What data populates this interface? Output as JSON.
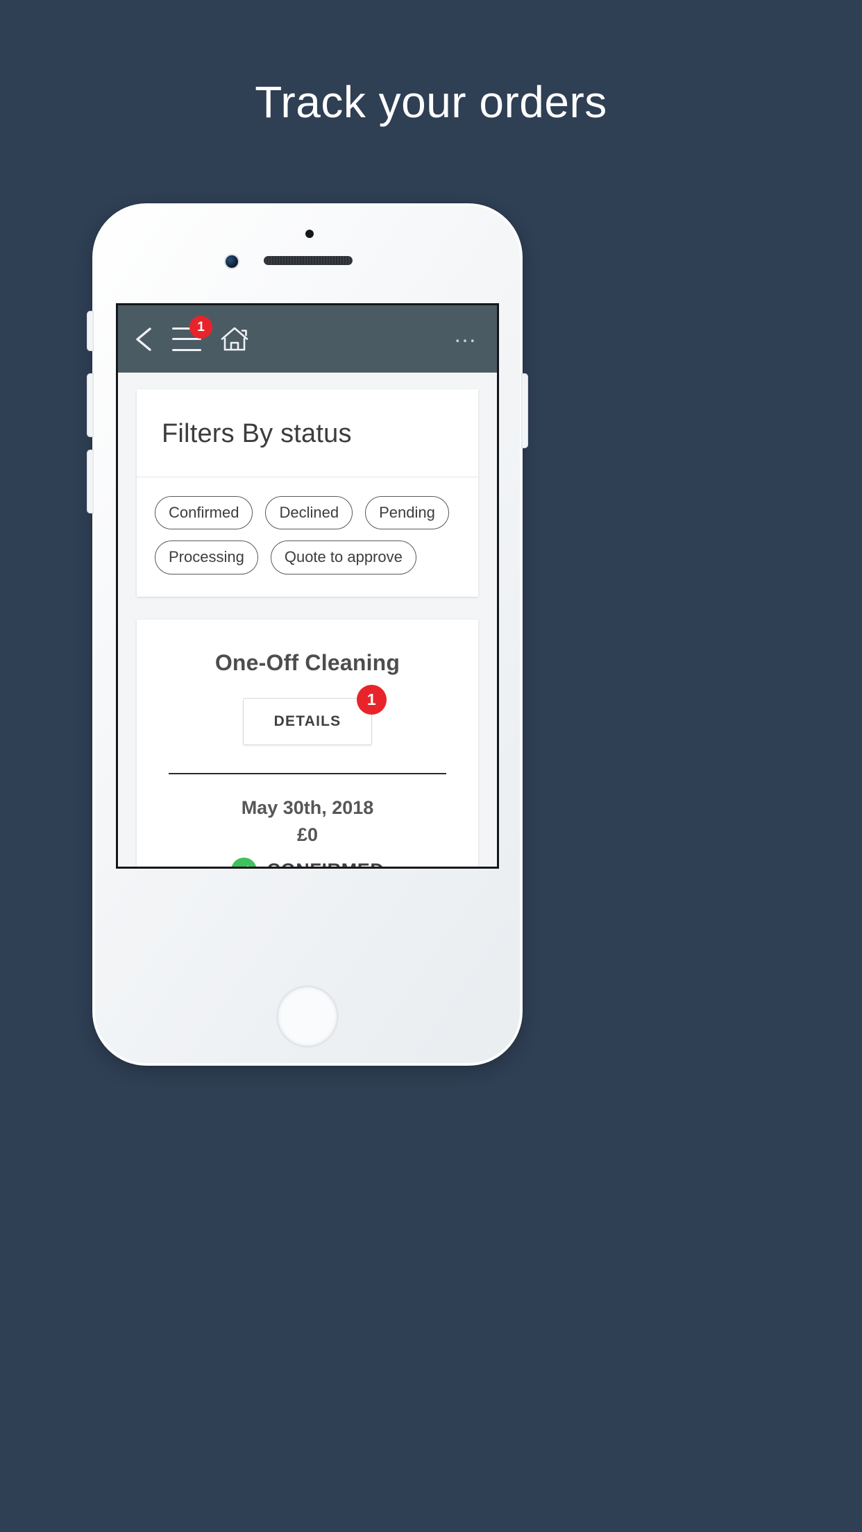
{
  "promo": {
    "title": "Track your orders",
    "background_color": "#2f3f54",
    "title_color": "#ffffff"
  },
  "app": {
    "header": {
      "background_color": "#4b5b64",
      "back_icon": "chevron-left-icon",
      "menu_icon": "hamburger-menu-icon",
      "menu_badge": "1",
      "home_icon": "home-icon",
      "overflow_label": "…",
      "badge_color": "#e8242a"
    },
    "filters_card": {
      "title": "Filters By status",
      "chips": [
        {
          "label": "Confirmed"
        },
        {
          "label": "Declined"
        },
        {
          "label": "Pending"
        },
        {
          "label": "Processing"
        },
        {
          "label": "Quote to approve"
        }
      ]
    },
    "order_card": {
      "title": "One-Off Cleaning",
      "details_label": "DETAILS",
      "details_badge": "1",
      "date": "May 30th, 2018",
      "price": "£0",
      "status_label": "CONFIRMED",
      "status_icon": "check-circle-icon",
      "status_color": "#3fc25d"
    }
  }
}
